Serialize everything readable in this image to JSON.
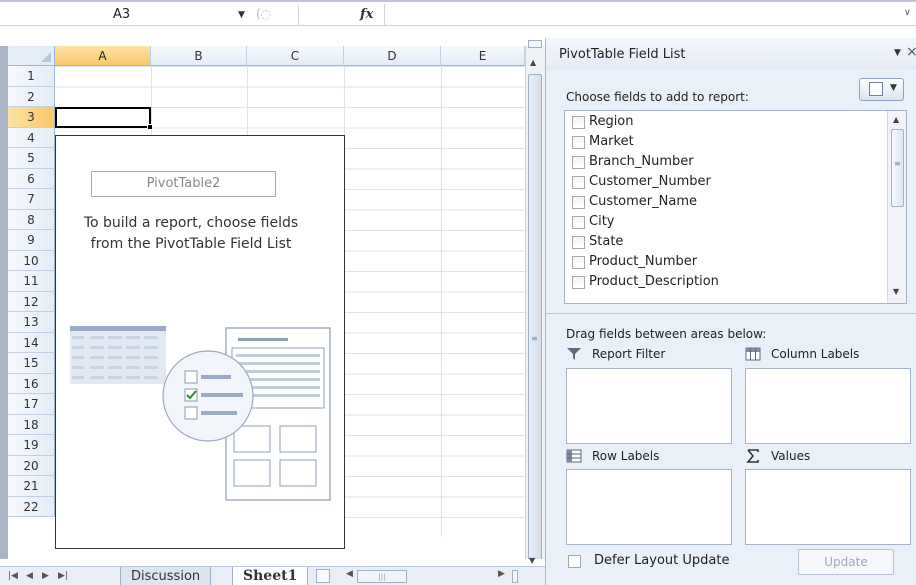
{
  "formula_bar": {
    "name_box": "A3",
    "fx_label": "fx",
    "formula": ""
  },
  "sheet": {
    "columns": [
      "A",
      "B",
      "C",
      "D",
      "E"
    ],
    "rows": [
      "1",
      "2",
      "3",
      "4",
      "5",
      "6",
      "7",
      "8",
      "9",
      "10",
      "11",
      "12",
      "13",
      "14",
      "15",
      "16",
      "17",
      "18",
      "19",
      "20",
      "21",
      "22"
    ],
    "selected_column": "A",
    "selected_row": "3",
    "pivot_table": {
      "name": "PivotTable2",
      "message": "To build a report, choose fields from the PivotTable Field List"
    },
    "tabs": [
      {
        "label": "Discussion",
        "active": false
      },
      {
        "label": "Sheet1",
        "active": true
      }
    ]
  },
  "field_list": {
    "title": "PivotTable Field List",
    "choose_label": "Choose fields to add to report:",
    "fields": [
      "Region",
      "Market",
      "Branch_Number",
      "Customer_Number",
      "Customer_Name",
      "City",
      "State",
      "Product_Number",
      "Product_Description"
    ],
    "drag_label": "Drag fields between areas below:",
    "areas": {
      "report_filter": "Report Filter",
      "column_labels": "Column Labels",
      "row_labels": "Row Labels",
      "values": "Values"
    },
    "defer_label": "Defer Layout Update",
    "update_button": "Update"
  },
  "colors": {
    "selected_header": "#f8c868",
    "panel_bg": "#eaf0f8",
    "grid_line": "#dde3ec"
  }
}
